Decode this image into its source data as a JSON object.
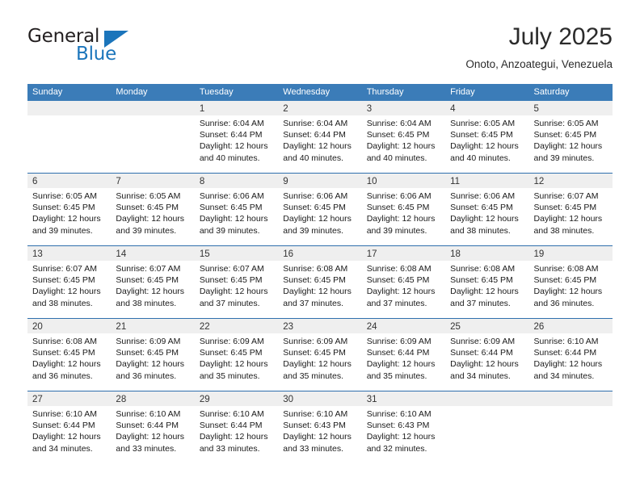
{
  "brand": {
    "name_part1": "General",
    "name_part2": "Blue",
    "triangle_icon": "triangle-icon",
    "colors": {
      "dark": "#231f20",
      "blue": "#1b75bb"
    }
  },
  "header": {
    "title": "July 2025",
    "subtitle": "Onoto, Anzoategui, Venezuela"
  },
  "calendar": {
    "accent_color": "#3b7cb8",
    "day_header_bg": "#efefef",
    "weekdays": [
      "Sunday",
      "Monday",
      "Tuesday",
      "Wednesday",
      "Thursday",
      "Friday",
      "Saturday"
    ],
    "weeks": [
      [
        {
          "day": "",
          "empty": true,
          "sunrise": "",
          "sunset": "",
          "daylight1": "",
          "daylight2": ""
        },
        {
          "day": "",
          "empty": true,
          "sunrise": "",
          "sunset": "",
          "daylight1": "",
          "daylight2": ""
        },
        {
          "day": "1",
          "empty": false,
          "sunrise": "Sunrise: 6:04 AM",
          "sunset": "Sunset: 6:44 PM",
          "daylight1": "Daylight: 12 hours",
          "daylight2": "and 40 minutes."
        },
        {
          "day": "2",
          "empty": false,
          "sunrise": "Sunrise: 6:04 AM",
          "sunset": "Sunset: 6:44 PM",
          "daylight1": "Daylight: 12 hours",
          "daylight2": "and 40 minutes."
        },
        {
          "day": "3",
          "empty": false,
          "sunrise": "Sunrise: 6:04 AM",
          "sunset": "Sunset: 6:45 PM",
          "daylight1": "Daylight: 12 hours",
          "daylight2": "and 40 minutes."
        },
        {
          "day": "4",
          "empty": false,
          "sunrise": "Sunrise: 6:05 AM",
          "sunset": "Sunset: 6:45 PM",
          "daylight1": "Daylight: 12 hours",
          "daylight2": "and 40 minutes."
        },
        {
          "day": "5",
          "empty": false,
          "sunrise": "Sunrise: 6:05 AM",
          "sunset": "Sunset: 6:45 PM",
          "daylight1": "Daylight: 12 hours",
          "daylight2": "and 39 minutes."
        }
      ],
      [
        {
          "day": "6",
          "empty": false,
          "sunrise": "Sunrise: 6:05 AM",
          "sunset": "Sunset: 6:45 PM",
          "daylight1": "Daylight: 12 hours",
          "daylight2": "and 39 minutes."
        },
        {
          "day": "7",
          "empty": false,
          "sunrise": "Sunrise: 6:05 AM",
          "sunset": "Sunset: 6:45 PM",
          "daylight1": "Daylight: 12 hours",
          "daylight2": "and 39 minutes."
        },
        {
          "day": "8",
          "empty": false,
          "sunrise": "Sunrise: 6:06 AM",
          "sunset": "Sunset: 6:45 PM",
          "daylight1": "Daylight: 12 hours",
          "daylight2": "and 39 minutes."
        },
        {
          "day": "9",
          "empty": false,
          "sunrise": "Sunrise: 6:06 AM",
          "sunset": "Sunset: 6:45 PM",
          "daylight1": "Daylight: 12 hours",
          "daylight2": "and 39 minutes."
        },
        {
          "day": "10",
          "empty": false,
          "sunrise": "Sunrise: 6:06 AM",
          "sunset": "Sunset: 6:45 PM",
          "daylight1": "Daylight: 12 hours",
          "daylight2": "and 39 minutes."
        },
        {
          "day": "11",
          "empty": false,
          "sunrise": "Sunrise: 6:06 AM",
          "sunset": "Sunset: 6:45 PM",
          "daylight1": "Daylight: 12 hours",
          "daylight2": "and 38 minutes."
        },
        {
          "day": "12",
          "empty": false,
          "sunrise": "Sunrise: 6:07 AM",
          "sunset": "Sunset: 6:45 PM",
          "daylight1": "Daylight: 12 hours",
          "daylight2": "and 38 minutes."
        }
      ],
      [
        {
          "day": "13",
          "empty": false,
          "sunrise": "Sunrise: 6:07 AM",
          "sunset": "Sunset: 6:45 PM",
          "daylight1": "Daylight: 12 hours",
          "daylight2": "and 38 minutes."
        },
        {
          "day": "14",
          "empty": false,
          "sunrise": "Sunrise: 6:07 AM",
          "sunset": "Sunset: 6:45 PM",
          "daylight1": "Daylight: 12 hours",
          "daylight2": "and 38 minutes."
        },
        {
          "day": "15",
          "empty": false,
          "sunrise": "Sunrise: 6:07 AM",
          "sunset": "Sunset: 6:45 PM",
          "daylight1": "Daylight: 12 hours",
          "daylight2": "and 37 minutes."
        },
        {
          "day": "16",
          "empty": false,
          "sunrise": "Sunrise: 6:08 AM",
          "sunset": "Sunset: 6:45 PM",
          "daylight1": "Daylight: 12 hours",
          "daylight2": "and 37 minutes."
        },
        {
          "day": "17",
          "empty": false,
          "sunrise": "Sunrise: 6:08 AM",
          "sunset": "Sunset: 6:45 PM",
          "daylight1": "Daylight: 12 hours",
          "daylight2": "and 37 minutes."
        },
        {
          "day": "18",
          "empty": false,
          "sunrise": "Sunrise: 6:08 AM",
          "sunset": "Sunset: 6:45 PM",
          "daylight1": "Daylight: 12 hours",
          "daylight2": "and 37 minutes."
        },
        {
          "day": "19",
          "empty": false,
          "sunrise": "Sunrise: 6:08 AM",
          "sunset": "Sunset: 6:45 PM",
          "daylight1": "Daylight: 12 hours",
          "daylight2": "and 36 minutes."
        }
      ],
      [
        {
          "day": "20",
          "empty": false,
          "sunrise": "Sunrise: 6:08 AM",
          "sunset": "Sunset: 6:45 PM",
          "daylight1": "Daylight: 12 hours",
          "daylight2": "and 36 minutes."
        },
        {
          "day": "21",
          "empty": false,
          "sunrise": "Sunrise: 6:09 AM",
          "sunset": "Sunset: 6:45 PM",
          "daylight1": "Daylight: 12 hours",
          "daylight2": "and 36 minutes."
        },
        {
          "day": "22",
          "empty": false,
          "sunrise": "Sunrise: 6:09 AM",
          "sunset": "Sunset: 6:45 PM",
          "daylight1": "Daylight: 12 hours",
          "daylight2": "and 35 minutes."
        },
        {
          "day": "23",
          "empty": false,
          "sunrise": "Sunrise: 6:09 AM",
          "sunset": "Sunset: 6:45 PM",
          "daylight1": "Daylight: 12 hours",
          "daylight2": "and 35 minutes."
        },
        {
          "day": "24",
          "empty": false,
          "sunrise": "Sunrise: 6:09 AM",
          "sunset": "Sunset: 6:44 PM",
          "daylight1": "Daylight: 12 hours",
          "daylight2": "and 35 minutes."
        },
        {
          "day": "25",
          "empty": false,
          "sunrise": "Sunrise: 6:09 AM",
          "sunset": "Sunset: 6:44 PM",
          "daylight1": "Daylight: 12 hours",
          "daylight2": "and 34 minutes."
        },
        {
          "day": "26",
          "empty": false,
          "sunrise": "Sunrise: 6:10 AM",
          "sunset": "Sunset: 6:44 PM",
          "daylight1": "Daylight: 12 hours",
          "daylight2": "and 34 minutes."
        }
      ],
      [
        {
          "day": "27",
          "empty": false,
          "sunrise": "Sunrise: 6:10 AM",
          "sunset": "Sunset: 6:44 PM",
          "daylight1": "Daylight: 12 hours",
          "daylight2": "and 34 minutes."
        },
        {
          "day": "28",
          "empty": false,
          "sunrise": "Sunrise: 6:10 AM",
          "sunset": "Sunset: 6:44 PM",
          "daylight1": "Daylight: 12 hours",
          "daylight2": "and 33 minutes."
        },
        {
          "day": "29",
          "empty": false,
          "sunrise": "Sunrise: 6:10 AM",
          "sunset": "Sunset: 6:44 PM",
          "daylight1": "Daylight: 12 hours",
          "daylight2": "and 33 minutes."
        },
        {
          "day": "30",
          "empty": false,
          "sunrise": "Sunrise: 6:10 AM",
          "sunset": "Sunset: 6:43 PM",
          "daylight1": "Daylight: 12 hours",
          "daylight2": "and 33 minutes."
        },
        {
          "day": "31",
          "empty": false,
          "sunrise": "Sunrise: 6:10 AM",
          "sunset": "Sunset: 6:43 PM",
          "daylight1": "Daylight: 12 hours",
          "daylight2": "and 32 minutes."
        },
        {
          "day": "",
          "empty": true,
          "sunrise": "",
          "sunset": "",
          "daylight1": "",
          "daylight2": ""
        },
        {
          "day": "",
          "empty": true,
          "sunrise": "",
          "sunset": "",
          "daylight1": "",
          "daylight2": ""
        }
      ]
    ]
  }
}
